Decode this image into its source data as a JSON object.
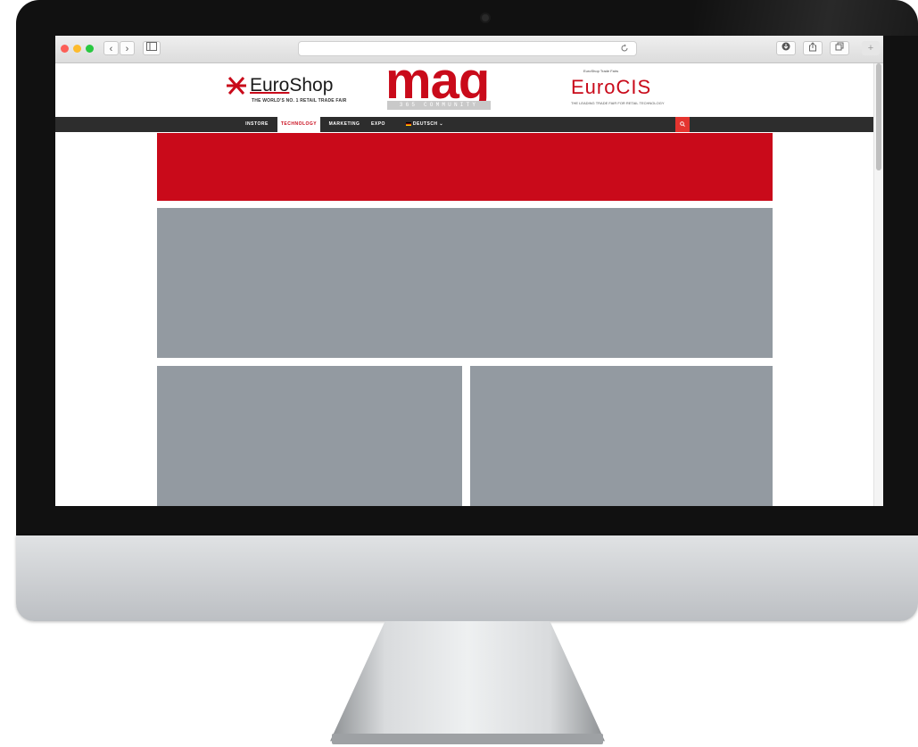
{
  "browser": {
    "back_glyph": "‹",
    "forward_glyph": "›",
    "icons": [
      "sidebar-icon",
      "reload-icon",
      "download-icon",
      "share-icon",
      "tabs-icon",
      "new-tab-icon"
    ],
    "new_tab_glyph": "+"
  },
  "header": {
    "euroshop": {
      "word_a": "Euro",
      "word_b": "Shop",
      "tagline": "THE WORLD'S NO. 1 RETAIL TRADE FAIR"
    },
    "mag": {
      "word": "mag",
      "subtitle": "365 COMMUNITY NEWS"
    },
    "eurocis": {
      "top": "EuroShop Trade Fairs",
      "word": "EuroCIS",
      "tagline": "THE LEADING TRADE FAIR FOR RETAIL TECHNOLOGY"
    }
  },
  "nav": {
    "items": [
      {
        "label": "INSTORE"
      },
      {
        "label": "TECHNOLOGY"
      },
      {
        "label": "MARKETING"
      },
      {
        "label": "EXPO"
      },
      {
        "label": "DEUTSCH ⌄"
      }
    ],
    "active": "TECHNOLOGY"
  },
  "colors": {
    "brand_red": "#c90a1a",
    "nav_bg": "#2d2d2d",
    "placeholder_gray": "#939aa1",
    "search_red": "#e4342f"
  }
}
